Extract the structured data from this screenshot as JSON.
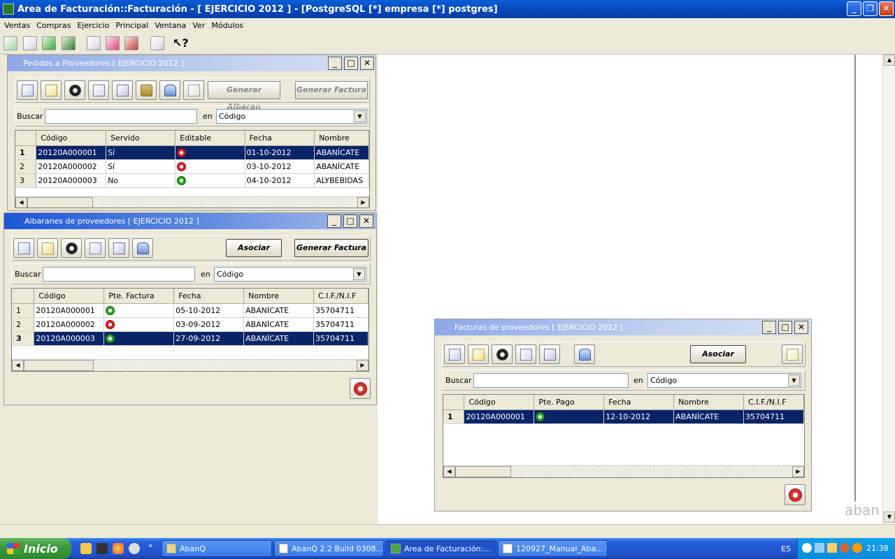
{
  "app": {
    "title": "Area de Facturación::Facturación  - [ EJERCICIO 2012 ] - [PostgreSQL [*] empresa [*] postgres]",
    "menu": [
      "Ventas",
      "Compras",
      "Ejercicio",
      "Principal",
      "Ventana",
      "Ver",
      "Módulos"
    ],
    "min": "_",
    "max": "❐",
    "close": "✕"
  },
  "watermark": "aban",
  "pedidos": {
    "title": "Pedidos a Proveedores [ EJERCICIO 2012 ]",
    "btn_albaran": "Generar Albaran",
    "btn_factura": "Generar Factura",
    "search_label": "Buscar",
    "en_label": "en",
    "combo": "Código",
    "columns": [
      "Código",
      "Servido",
      "Editable",
      "Fecha",
      "Nombre"
    ],
    "rows": [
      {
        "n": "1",
        "codigo": "20120A000001",
        "servido": "Sí",
        "editable": "red",
        "fecha": "01-10-2012",
        "nombre": "ABANÍCATE",
        "selected": true
      },
      {
        "n": "2",
        "codigo": "20120A000002",
        "servido": "Sí",
        "editable": "red",
        "fecha": "03-10-2012",
        "nombre": "ABANÍCATE",
        "selected": false
      },
      {
        "n": "3",
        "codigo": "20120A000003",
        "servido": "No",
        "editable": "green",
        "fecha": "04-10-2012",
        "nombre": "ALYBEBIDAS",
        "selected": false
      }
    ]
  },
  "albaranes": {
    "title": "Albaranes de proveedores [ EJERCICIO 2012 ]",
    "btn_asociar": "Asociar",
    "btn_factura": "Generar Factura",
    "search_label": "Buscar",
    "en_label": "en",
    "combo": "Código",
    "columns": [
      "Código",
      "Pte. Factura",
      "Fecha",
      "Nombre",
      "C.I.F./N.I.F"
    ],
    "rows": [
      {
        "n": "1",
        "codigo": "20120A000001",
        "pte": "green",
        "fecha": "05-10-2012",
        "nombre": "ABANÍCATE",
        "cif": "35704711",
        "selected": false
      },
      {
        "n": "2",
        "codigo": "20120A000002",
        "pte": "red",
        "fecha": "03-09-2012",
        "nombre": "ABANÍCATE",
        "cif": "35704711",
        "selected": false
      },
      {
        "n": "3",
        "codigo": "20120A000003",
        "pte": "green",
        "fecha": "27-09-2012",
        "nombre": "ABANÍCATE",
        "cif": "35704711",
        "selected": true
      }
    ]
  },
  "facturas": {
    "title": "Facturas de proveedores [ EJERCICIO 2012 ]",
    "btn_asociar": "Asociar",
    "search_label": "Buscar",
    "en_label": "en",
    "combo": "Código",
    "columns": [
      "Código",
      "Pte. Pago",
      "Fecha",
      "Nombre",
      "C.I.F./N.I.F"
    ],
    "rows": [
      {
        "n": "1",
        "codigo": "20120A000001",
        "pte": "green",
        "fecha": "12-10-2012",
        "nombre": "ABANÍCATE",
        "cif": "35704711",
        "selected": true
      }
    ]
  },
  "taskbar": {
    "start": "Inicio",
    "more": "»",
    "tasks": [
      "AbanQ",
      "AbanQ 2.2 Build 0308...",
      "Area de Facturación:...",
      "120927_Manual_Aba..."
    ],
    "lang": "ES",
    "clock": "21:38"
  },
  "colors": {
    "selection": "#0a246a",
    "titlebar": "#0846b8",
    "taskbar": "#245edb"
  }
}
